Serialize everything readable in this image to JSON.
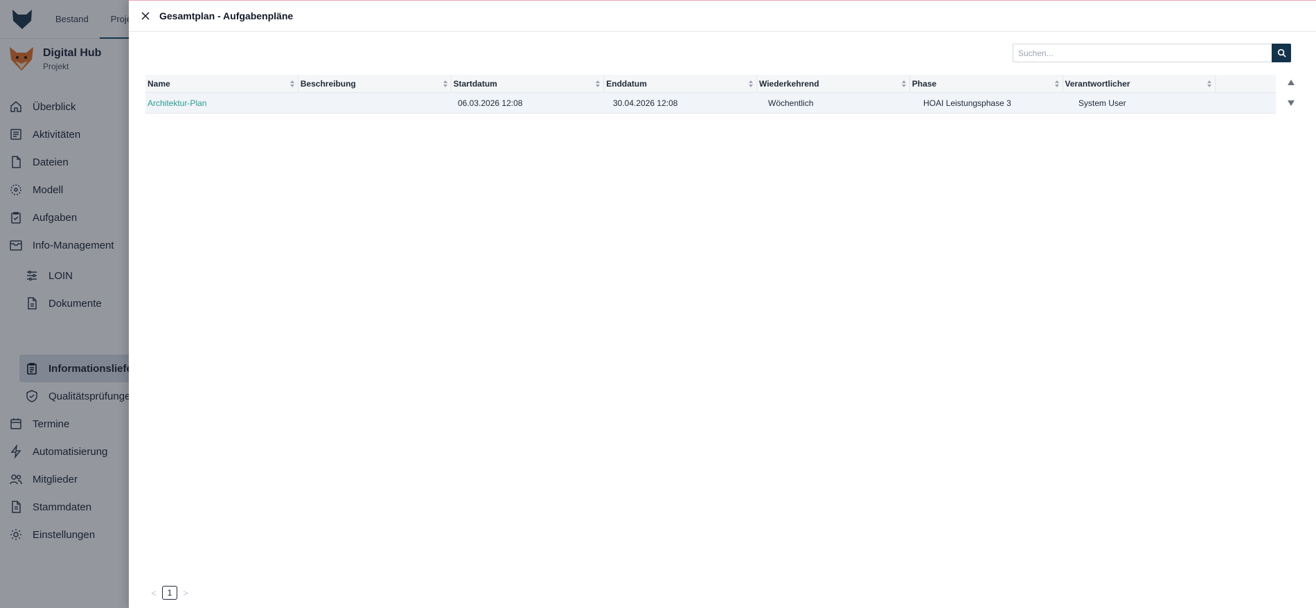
{
  "app": {
    "top_nav": [
      "Bestand",
      "Projekte"
    ],
    "project": {
      "title": "Digital Hub",
      "subtitle": "Projekt"
    },
    "sidebar": {
      "items": [
        {
          "label": "Überblick",
          "icon": "home-icon"
        },
        {
          "label": "Aktivitäten",
          "icon": "activity-icon"
        },
        {
          "label": "Dateien",
          "icon": "file-icon"
        },
        {
          "label": "Modell",
          "icon": "model-icon"
        },
        {
          "label": "Aufgaben",
          "icon": "clipboard-check-icon"
        },
        {
          "label": "Info-Management",
          "icon": "inbox-icon"
        },
        {
          "label": "LOIN",
          "icon": "sliders-icon"
        },
        {
          "label": "Dokumente",
          "icon": "document-icon"
        },
        {
          "label": "Informationslieferungen",
          "icon": "clipboard-list-icon"
        },
        {
          "label": "Qualitätsprüfungen",
          "icon": "shield-check-icon"
        },
        {
          "label": "Termine",
          "icon": "calendar-icon"
        },
        {
          "label": "Automatisierung",
          "icon": "lightning-icon"
        },
        {
          "label": "Mitglieder",
          "icon": "users-icon"
        },
        {
          "label": "Stammdaten",
          "icon": "data-file-icon"
        },
        {
          "label": "Einstellungen",
          "icon": "gear-icon"
        }
      ]
    }
  },
  "drawer": {
    "title": "Gesamtplan - Aufgabenpläne",
    "search": {
      "placeholder": "Suchen...",
      "value": ""
    },
    "table": {
      "columns": [
        "Name",
        "Beschreibung",
        "Startdatum",
        "Enddatum",
        "Wiederkehrend",
        "Phase",
        "Verantwortlicher"
      ],
      "rows": [
        {
          "name": "Architektur-Plan",
          "description": "",
          "start": "06.03.2026 12:08",
          "end": "30.04.2026 12:08",
          "recurring": "Wöchentlich",
          "phase": "HOAI Leistungsphase 3",
          "responsible": "System User"
        }
      ]
    },
    "pagination": {
      "prev": "<",
      "current": "1",
      "next": ">"
    }
  },
  "colors": {
    "primary": "#12334a",
    "link": "#2a9d8f",
    "active_nav": "#dbe2ea",
    "overlay": "rgba(17,24,39,0.45)"
  }
}
